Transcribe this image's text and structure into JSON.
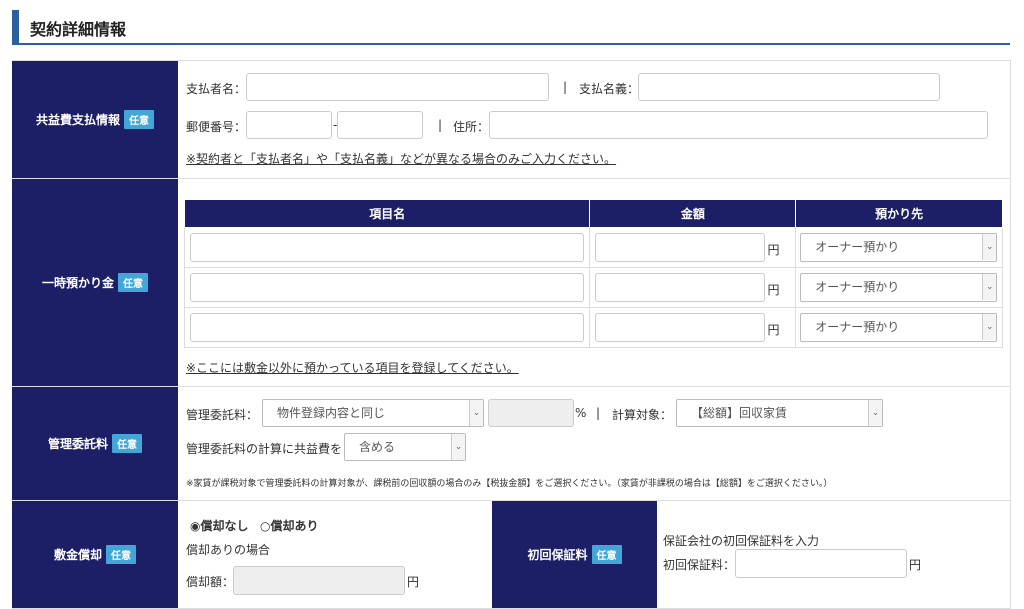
{
  "page": {
    "title": "契約詳細情報"
  },
  "badge": "任意",
  "yen": "円",
  "payer": {
    "heading": "共益費支払情報",
    "payer_name_label": "支払者名：",
    "separator": "|",
    "account_name_label": "支払名義：",
    "postal_label": "郵便番号：",
    "postal_dash": "-",
    "address_label": "住所：",
    "note": "※契約者と「支払者名」や「支払名義」などが異なる場合のみご入力ください。"
  },
  "deposit": {
    "heading": "一時預かり金",
    "columns": [
      "項目名",
      "金額",
      "預かり先"
    ],
    "rows": [
      {
        "item": "",
        "amount": "",
        "holder": "オーナー預かり"
      },
      {
        "item": "",
        "amount": "",
        "holder": "オーナー預かり"
      },
      {
        "item": "",
        "amount": "",
        "holder": "オーナー預かり"
      }
    ],
    "note": "※ここには敷金以外に預かっている項目を登録してください。"
  },
  "management": {
    "heading": "管理委託料",
    "fee_label": "管理委託料：",
    "fee_select": "物件登録内容と同じ",
    "percent": "%",
    "separator": "|",
    "target_label": "計算対象：",
    "target_select": "【総額】回収家賃",
    "common_label": "管理委託料の計算に共益費を",
    "common_select": "含める",
    "note": "※家賃が課税対象で管理委託料の計算対象が、課税前の回収額の場合のみ【税抜金額】をご選択ください。（家賃が非課税の場合は【総額】をご選択ください。）"
  },
  "amortization": {
    "heading": "敷金償却",
    "option_none": "◉償却なし",
    "option_yes": "○償却あり",
    "case_label": "償却ありの場合",
    "amount_label": "償却額："
  },
  "guarantee": {
    "heading": "初回保証料",
    "desc": "保証会社の初回保証料を入力",
    "fee_label": "初回保証料："
  },
  "icons": {
    "dropdown": "chevron-down-icon"
  }
}
